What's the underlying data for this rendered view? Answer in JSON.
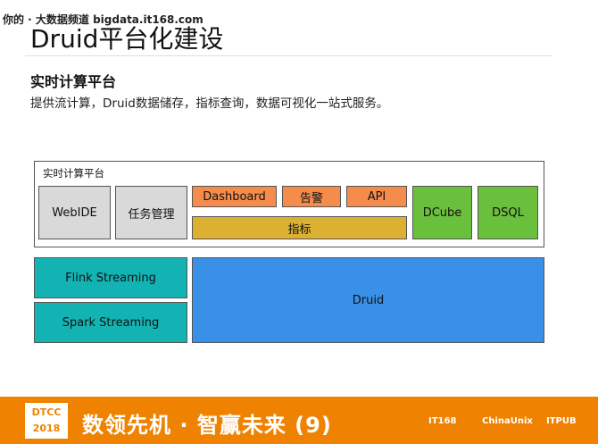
{
  "watermark": "你的 · 大数据频道 bigdata.it168.com",
  "title": "Druid平台化建设",
  "subtitle": "实时计算平台",
  "description": "提供流计算，Druid数据储存，指标查询，数据可视化一站式服务。",
  "diagram": {
    "frame_label": "实时计算平台",
    "webide": "WebIDE",
    "task": "任务管理",
    "dashboard": "Dashboard",
    "alert": "告警",
    "api": "API",
    "metric": "指标",
    "dcube": "DCube",
    "dsql": "DSQL",
    "flink": "Flink Streaming",
    "spark": "Spark Streaming",
    "druid": "Druid"
  },
  "footer": {
    "logo_top": "DTCC",
    "logo_year": "2018",
    "slogan": "数领先机 · 智赢未来 (9)",
    "sponsors": [
      "IT168",
      "ChinaUnix",
      "ITPUB"
    ]
  }
}
